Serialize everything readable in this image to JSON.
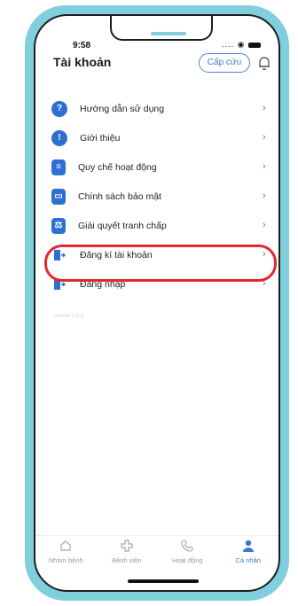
{
  "status": {
    "time": "9:58"
  },
  "header": {
    "title": "Tài khoản",
    "emergency_label": "Cấp cứu"
  },
  "menu": [
    {
      "label": "Hướng dẫn sử dụng",
      "icon": "help-circle-icon"
    },
    {
      "label": "Giới thiệu",
      "icon": "info-circle-icon"
    },
    {
      "label": "Quy chế hoạt động",
      "icon": "document-icon"
    },
    {
      "label": "Chính sách bảo mật",
      "icon": "lock-card-icon"
    },
    {
      "label": "Giải quyết tranh chấp",
      "icon": "gavel-icon"
    },
    {
      "label": "Đăng kí tài khoản",
      "icon": "door-enter-icon"
    },
    {
      "label": "Đăng nhập",
      "icon": "door-login-icon"
    }
  ],
  "version": "version 1.0.3",
  "tabs": [
    {
      "label": "Nhóm bệnh",
      "icon": "home-icon"
    },
    {
      "label": "Bệnh viện",
      "icon": "hospital-cross-icon"
    },
    {
      "label": "Hoạt động",
      "icon": "phone-call-icon"
    },
    {
      "label": "Cá nhân",
      "icon": "person-icon"
    }
  ],
  "colors": {
    "accent": "#3c78cf",
    "frame": "#7fcfdc",
    "highlight": "#e3272d"
  }
}
